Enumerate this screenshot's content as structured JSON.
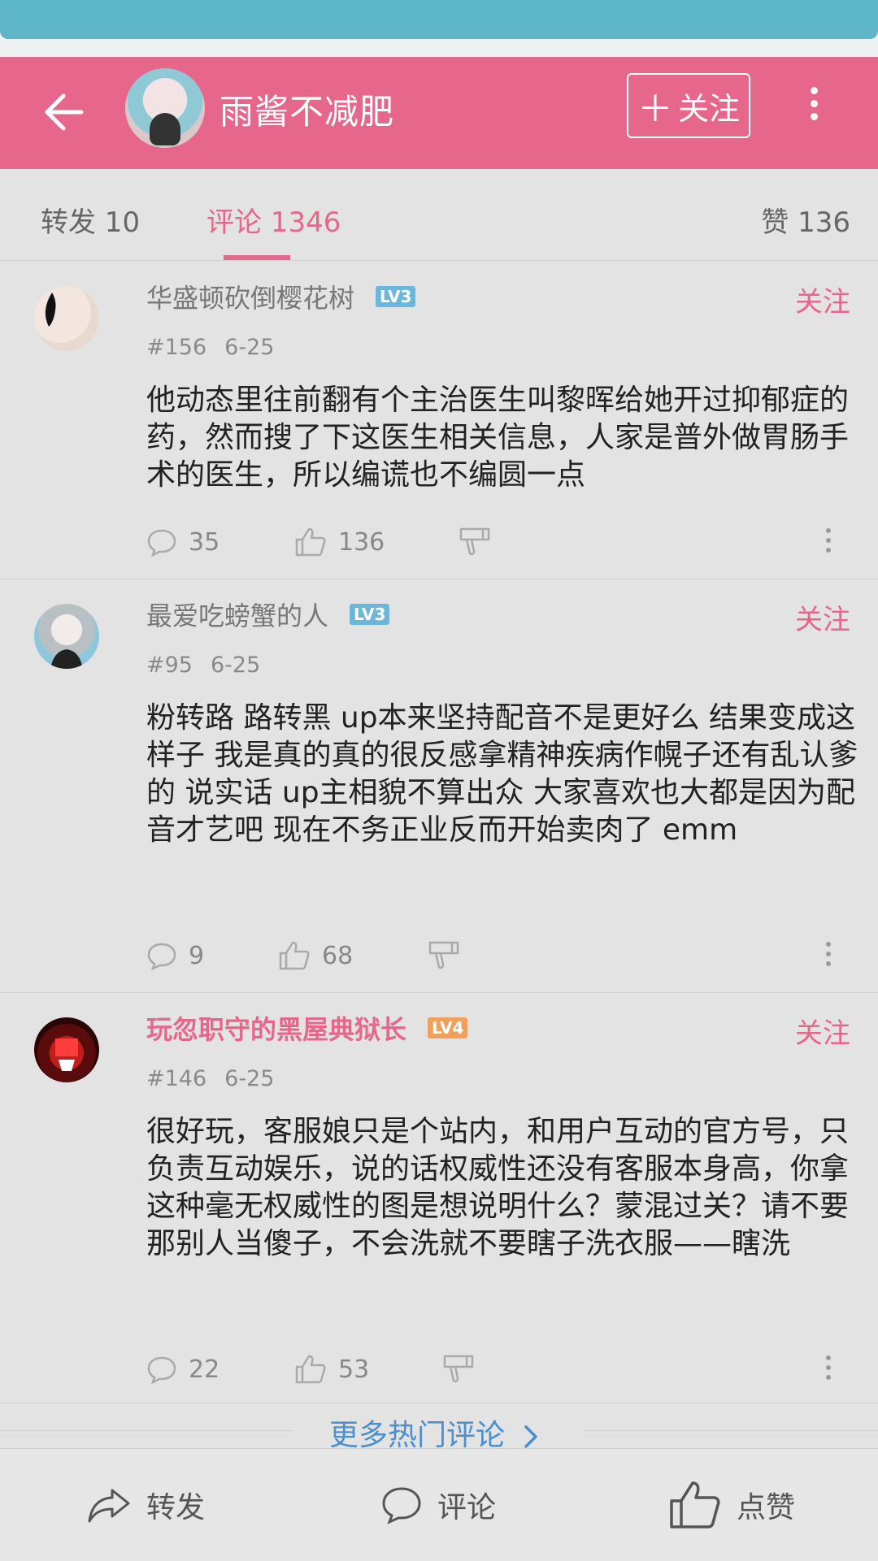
{
  "header": {
    "title": "雨酱不减肥",
    "follow_label": "关注",
    "follow_plus": "＋"
  },
  "tabs": {
    "repost": "转发 10",
    "comments": "评论 1346",
    "likes": "赞 136"
  },
  "comments": [
    {
      "name": "华盛顿砍倒樱花树",
      "level": "LV3",
      "level_color": "#6bb6d9",
      "follow": "关注",
      "floor": "#156",
      "date": "6-25",
      "text": "他动态里往前翻有个主治医生叫黎晖给她开过抑郁症的药，然而搜了下这医生相关信息，人家是普外做胃肠手术的医生，所以编谎也不编圆一点",
      "reply_count": "35",
      "like_count": "136"
    },
    {
      "name": "最爱吃螃蟹的人",
      "level": "LV3",
      "level_color": "#6bb6d9",
      "follow": "关注",
      "floor": "#95",
      "date": "6-25",
      "text": "粉转路 路转黑 up本来坚持配音不是更好么 结果变成这样子 我是真的真的很反感拿精神疾病作幌子还有乱认爹的 说实话 up主相貌不算出众 大家喜欢也大都是因为配音才艺吧 现在不务正业反而开始卖肉了 emm",
      "reply_count": "9",
      "like_count": "68"
    },
    {
      "name": "玩忽职守的黑屋典狱长",
      "level": "LV4",
      "level_color": "#f0a05a",
      "follow": "关注",
      "floor": "#146",
      "date": "6-25",
      "text": "很好玩，客服娘只是个站内，和用户互动的官方号，只负责互动娱乐，说的话权威性还没有客服本身高，你拿这种毫无权威性的图是想说明什么？蒙混过关？请不要那别人当傻子，不会洗就不要瞎子洗衣服——瞎洗",
      "reply_count": "22",
      "like_count": "53"
    }
  ],
  "more_hot_comments": "更多热门评论",
  "bottom_bar": {
    "repost": "转发",
    "comment": "评论",
    "like": "点赞"
  }
}
